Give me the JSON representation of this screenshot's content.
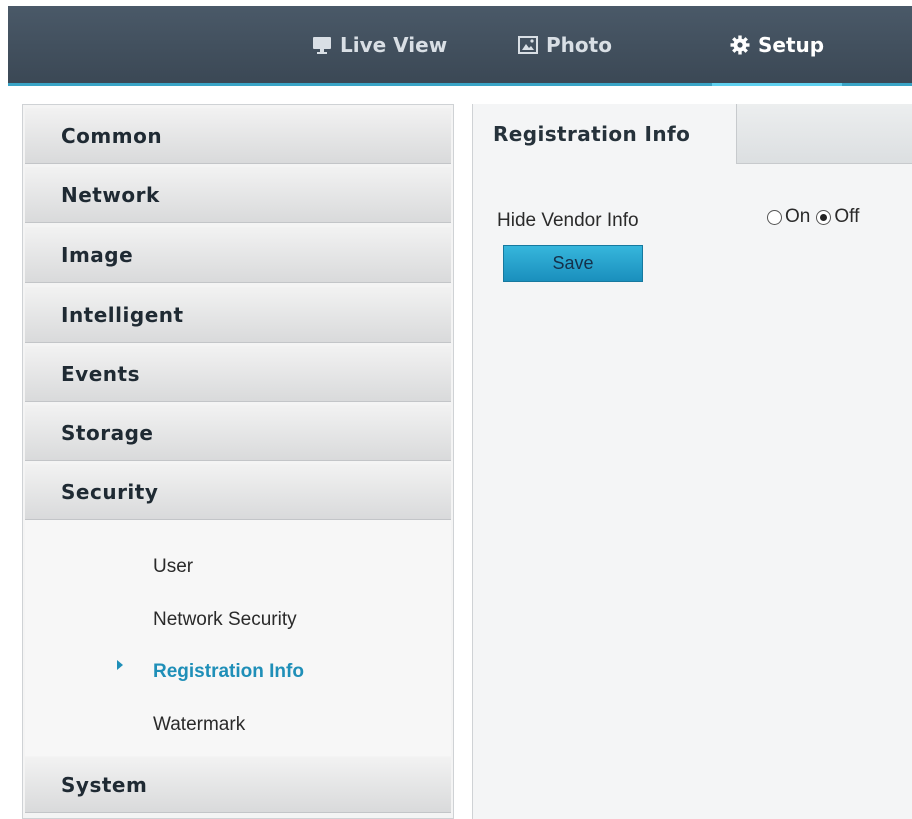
{
  "topnav": {
    "items": [
      {
        "label": "Live View",
        "icon": "monitor-icon",
        "active": false
      },
      {
        "label": "Photo",
        "icon": "picture-icon",
        "active": false
      },
      {
        "label": "Setup",
        "icon": "gear-icon",
        "active": true
      }
    ]
  },
  "sidebar": {
    "sections": [
      {
        "label": "Common"
      },
      {
        "label": "Network"
      },
      {
        "label": "Image"
      },
      {
        "label": "Intelligent"
      },
      {
        "label": "Events"
      },
      {
        "label": "Storage"
      },
      {
        "label": "Security"
      },
      {
        "label": "System"
      }
    ],
    "security_items": [
      {
        "label": "User"
      },
      {
        "label": "Network Security"
      },
      {
        "label": "Registration Info",
        "active": true
      },
      {
        "label": "Watermark"
      }
    ]
  },
  "content": {
    "tab_label": "Registration Info",
    "hide_vendor_label": "Hide Vendor Info",
    "radio_on_label": "On",
    "radio_off_label": "Off",
    "selected": "Off",
    "save_label": "Save"
  },
  "colors": {
    "accent": "#3aa4c6",
    "active_text": "#1f8fb8",
    "topbar": "#3f4c59",
    "button": "#2aa3cf"
  }
}
